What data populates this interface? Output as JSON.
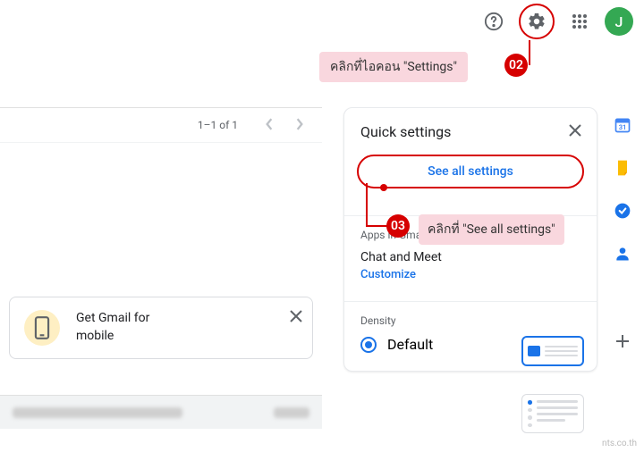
{
  "topbar": {
    "avatar_initial": "J"
  },
  "callouts": {
    "step02_text": "คลิกที่ไอคอน \"Settings\"",
    "step02_num": "02",
    "step03_text": "คลิกที่ \"See all settings\"",
    "step03_num": "03"
  },
  "list": {
    "count": "1–1 of 1"
  },
  "promo": {
    "line1": "Get Gmail for",
    "line2": "mobile"
  },
  "quick_settings": {
    "title": "Quick settings",
    "see_all": "See all settings",
    "apps_label": "Apps in Gmail",
    "apps_row": "Chat and Meet",
    "customize": "Customize",
    "density_label": "Density",
    "density_default": "Default"
  },
  "watermark": "nts.co.th"
}
